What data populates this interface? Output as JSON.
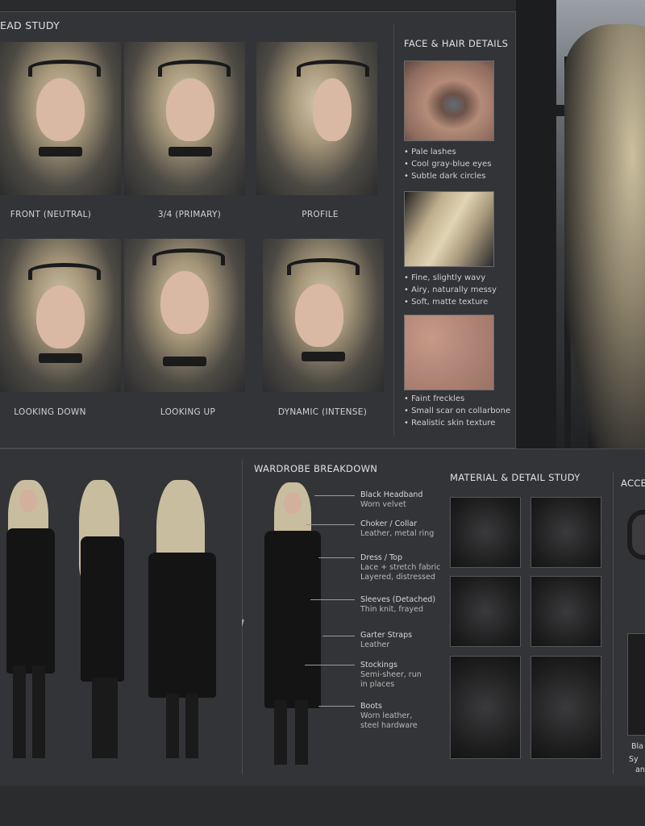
{
  "head_study": {
    "title": "EAD STUDY",
    "views": [
      {
        "label": "FRONT (NEUTRAL)"
      },
      {
        "label": "3/4 (PRIMARY)"
      },
      {
        "label": "PROFILE"
      },
      {
        "label": "LOOKING DOWN"
      },
      {
        "label": "LOOKING UP"
      },
      {
        "label": "DYNAMIC (INTENSE)"
      }
    ]
  },
  "face_hair": {
    "title": "FACE & HAIR DETAILS",
    "groups": [
      {
        "bullets": [
          "Pale lashes",
          "Cool gray-blue eyes",
          "Subtle dark circles"
        ]
      },
      {
        "bullets": [
          "Fine, slightly wavy",
          "Airy, naturally messy",
          "Soft, matte texture"
        ]
      },
      {
        "bullets": [
          "Faint freckles",
          "Small scar on collarbone",
          "Realistic skin texture"
        ]
      }
    ]
  },
  "wardrobe": {
    "title": "WARDROBE BREAKDOWN",
    "items": [
      {
        "name": "Black Headband",
        "detail": [
          "Worn velvet"
        ]
      },
      {
        "name": "Choker / Collar",
        "detail": [
          "Leather, metal ring"
        ]
      },
      {
        "name": "Dress / Top",
        "detail": [
          "Lace + stretch fabric",
          "Layered, distressed"
        ]
      },
      {
        "name": "Sleeves (Detached)",
        "detail": [
          "Thin knit, frayed"
        ]
      },
      {
        "name": "Garter Straps",
        "detail": [
          "Leather"
        ]
      },
      {
        "name": "Stockings",
        "detail": [
          "Semi-sheer, run",
          "in places"
        ]
      },
      {
        "name": "Boots",
        "detail": [
          "Worn leather,",
          "steel hardware"
        ]
      }
    ]
  },
  "material": {
    "title": "MATERIAL & DETAIL STUDY"
  },
  "accessories": {
    "title": "ACCES",
    "caption": "Bla",
    "bullet": "Sy",
    "extra": "an"
  }
}
